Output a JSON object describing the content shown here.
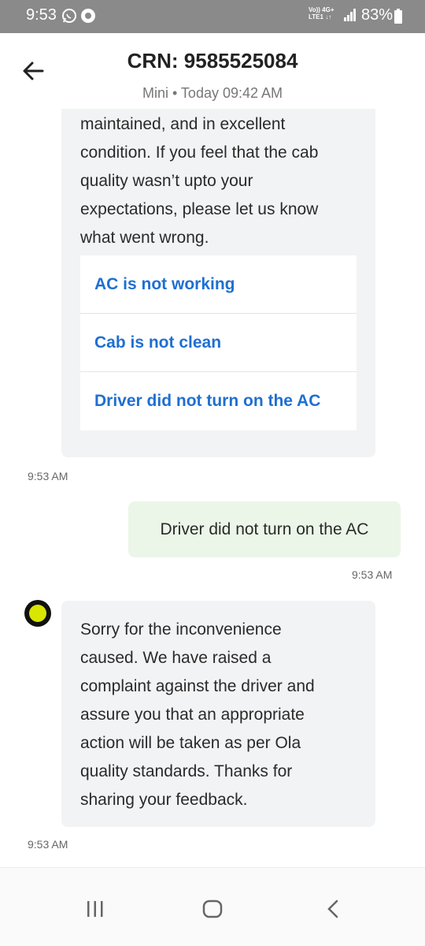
{
  "status_bar": {
    "time": "9:53",
    "icons": [
      "whatsapp-icon",
      "ola-notification-icon"
    ],
    "network_line1": "Vo)) 4G+",
    "network_line2": "LTE1 ↓↑",
    "battery": "83%"
  },
  "header": {
    "crn": "CRN: 9585525084",
    "ride_info": "Mini • Today 09:42 AM"
  },
  "chat": {
    "bot_message_1": {
      "lines": [
        "maintained, and in excellent",
        "condition. If you feel that the cab",
        "quality wasn’t upto your",
        "expectations, please let us know",
        "what went wrong."
      ],
      "options": [
        "AC is not working",
        "Cab is not clean",
        "Driver did not turn on the AC"
      ],
      "time": "9:53 AM"
    },
    "user_message": {
      "text": "Driver did not turn on the AC",
      "time": "9:53 AM"
    },
    "bot_message_2": {
      "lines": [
        "Sorry for the inconvenience",
        "caused. We have raised a",
        "complaint against the driver and",
        "assure you that an appropriate",
        "action will be taken as per Ola",
        "quality standards. Thanks for",
        "sharing your feedback."
      ],
      "time": "9:53 AM"
    }
  },
  "nav_bar": {
    "icons": [
      "recent-apps-icon",
      "home-icon",
      "back-nav-icon"
    ]
  },
  "colors": {
    "option_text": "#1f6fd1",
    "bot_bubble": "#f2f3f5",
    "user_bubble": "#ebf6e8",
    "ola_yellow": "#d8e600"
  }
}
